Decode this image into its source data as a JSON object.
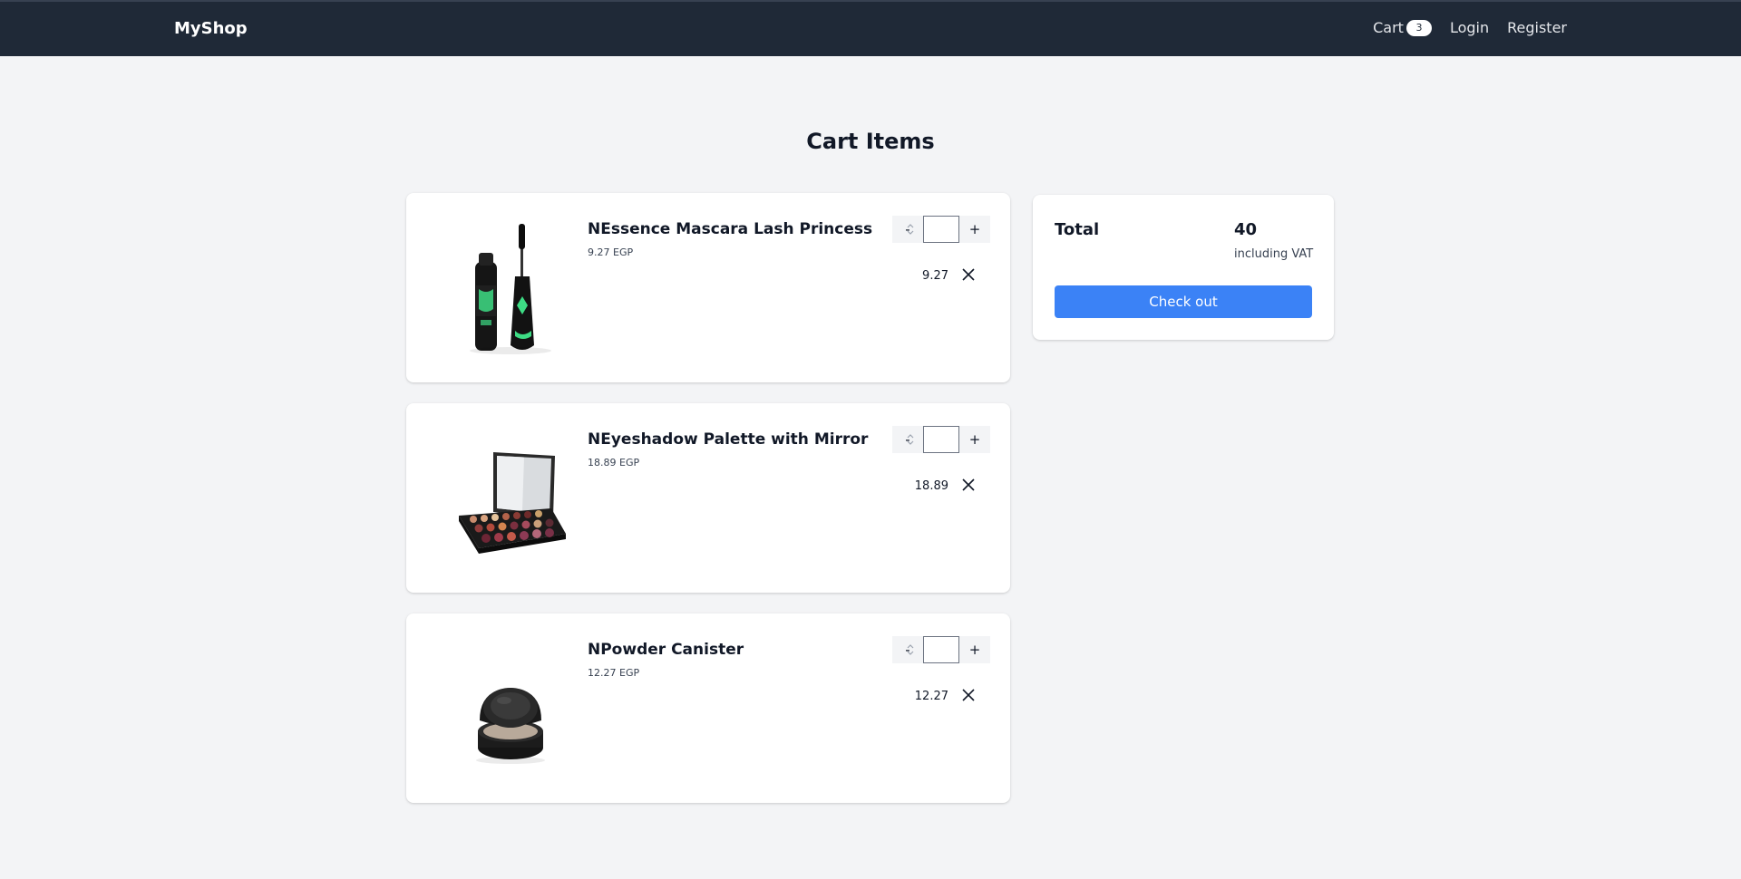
{
  "header": {
    "brand": "MyShop",
    "cart_label": "Cart",
    "cart_count": "3",
    "login": "Login",
    "register": "Register"
  },
  "page": {
    "title": "Cart Items"
  },
  "items": [
    {
      "name": "NEssence Mascara Lash Princess",
      "unit_price": "9.27 EGP",
      "line_total": "9.27",
      "image": "mascara-image"
    },
    {
      "name": "NEyeshadow Palette with Mirror",
      "unit_price": "18.89 EGP",
      "line_total": "18.89",
      "image": "eyeshadow-palette-image"
    },
    {
      "name": "NPowder Canister",
      "unit_price": "12.27 EGP",
      "line_total": "12.27",
      "image": "powder-canister-image"
    }
  ],
  "quantity_controls": {
    "decrement": "-",
    "increment": "+"
  },
  "summary": {
    "total_label": "Total",
    "total_value": "40",
    "vat_note": "including VAT",
    "checkout_label": "Check out"
  },
  "colors": {
    "header_bg": "#1f2937",
    "page_bg": "#f3f4f6",
    "primary_button": "#3b82f6"
  }
}
